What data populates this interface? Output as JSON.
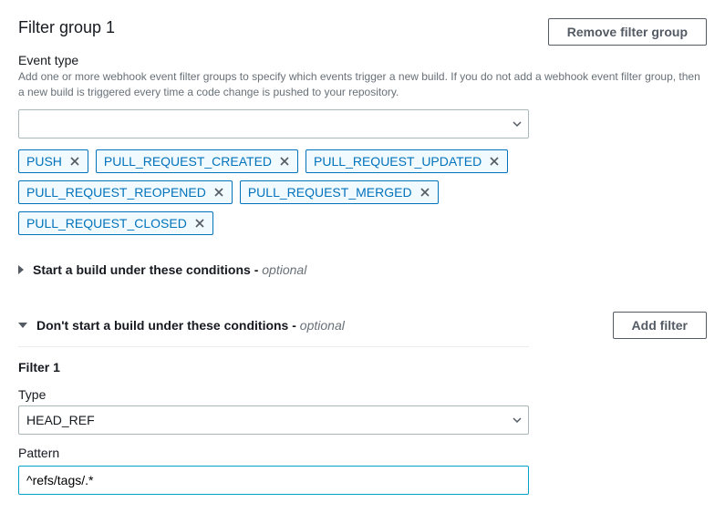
{
  "header": {
    "title": "Filter group 1",
    "remove_label": "Remove filter group"
  },
  "event_type": {
    "label": "Event type",
    "help": "Add one or more webhook event filter groups to specify which events trigger a new build. If you do not add a webhook event filter group, then a new build is triggered every time a code change is pushed to your repository.",
    "selected": "",
    "tags": [
      "PUSH",
      "PULL_REQUEST_CREATED",
      "PULL_REQUEST_UPDATED",
      "PULL_REQUEST_REOPENED",
      "PULL_REQUEST_MERGED",
      "PULL_REQUEST_CLOSED"
    ]
  },
  "expanders": {
    "start": {
      "title": "Start a build under these conditions",
      "suffix": "- ",
      "optional": "optional",
      "expanded": false
    },
    "dont_start": {
      "title": "Don't start a build under these conditions",
      "suffix": "- ",
      "optional": "optional",
      "expanded": true,
      "add_filter_label": "Add filter"
    }
  },
  "filter": {
    "heading": "Filter 1",
    "type_label": "Type",
    "type_value": "HEAD_REF",
    "pattern_label": "Pattern",
    "pattern_value": "^refs/tags/.*"
  }
}
